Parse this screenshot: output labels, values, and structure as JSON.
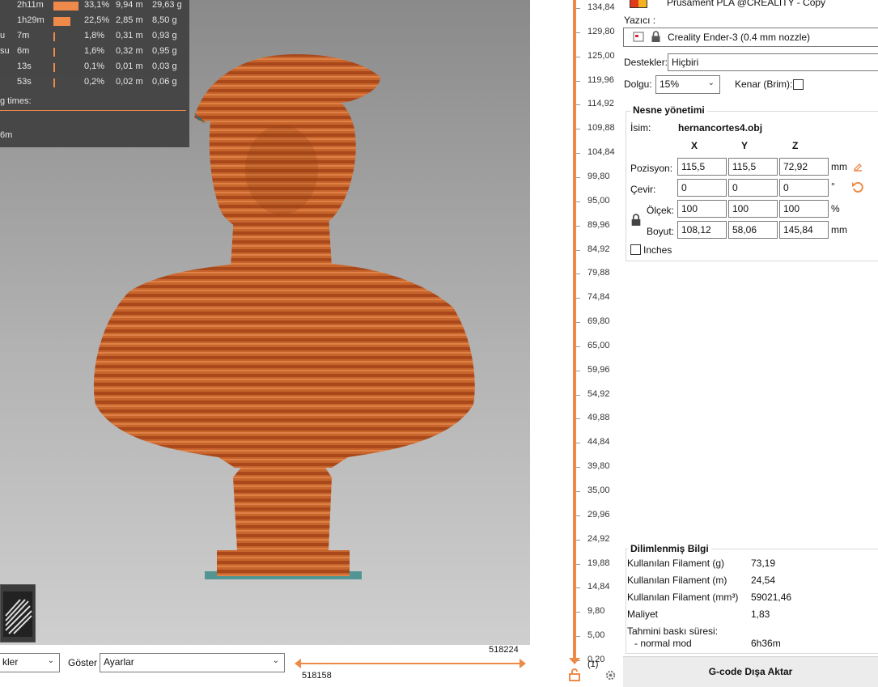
{
  "stats": {
    "rows": [
      {
        "name": "",
        "time": "2h11m",
        "pct": "33,1%",
        "length": "9,94 m",
        "weight": "29,63 g",
        "fraction": 1.0
      },
      {
        "name": "",
        "time": "1h29m",
        "pct": "22,5%",
        "length": "2,85 m",
        "weight": "8,50 g",
        "fraction": 0.68
      },
      {
        "name": "u",
        "time": "7m",
        "pct": "1,8%",
        "length": "0,31 m",
        "weight": "0,93 g",
        "fraction": 0.05
      },
      {
        "name": "su",
        "time": "6m",
        "pct": "1,6%",
        "length": "0,32 m",
        "weight": "0,95 g",
        "fraction": 0.05
      },
      {
        "name": "",
        "time": "13s",
        "pct": "0,1%",
        "length": "0,01 m",
        "weight": "0,03 g",
        "fraction": 0.02
      },
      {
        "name": "",
        "time": "53s",
        "pct": "0,2%",
        "length": "0,02 m",
        "weight": "0,06 g",
        "fraction": 0.02
      }
    ],
    "times_label": "g times:",
    "time_value": "6m"
  },
  "bottom": {
    "view_combo": "kler",
    "show_label": "Göster",
    "show_combo": "Ayarlar",
    "slider_top_value": "518224",
    "slider_bottom_value": "518158"
  },
  "vslider": {
    "labels": [
      "134,84",
      "129,80",
      "125,00",
      "119,96",
      "114,92",
      "109,88",
      "104,84",
      "99,80",
      "95,00",
      "89,96",
      "84,92",
      "79,88",
      "74,84",
      "69,80",
      "65,00",
      "59,96",
      "54,92",
      "49,88",
      "44,84",
      "39,80",
      "35,00",
      "29,96",
      "24,92",
      "19,88",
      "14,84",
      "9,80",
      "5,00",
      "0,20"
    ],
    "bottom_count": "(1)",
    "accent": "#ed8a47"
  },
  "panel": {
    "filament_name": "Prusament PLA @CREALITY - Copy",
    "printer_label": "Yazıcı :",
    "printer_name": "Creality Ender-3 (0.4 mm nozzle)",
    "supports_label": "Destekler:",
    "supports_value": "Hiçbiri",
    "infill_label": "Dolgu:",
    "infill_value": "15%",
    "brim_label": "Kenar (Brim):",
    "object": {
      "title": "Nesne yönetimi",
      "name_label": "İsim:",
      "name_value": "hernancortes4.obj",
      "col_x": "X",
      "col_y": "Y",
      "col_z": "Z",
      "position_label": "Pozisyon:",
      "position": [
        "115,5",
        "115,5",
        "72,92"
      ],
      "position_unit": "mm",
      "rotate_label": "Çevir:",
      "rotate": [
        "0",
        "0",
        "0"
      ],
      "rotate_unit": "°",
      "scale_label": "Ölçek:",
      "scale": [
        "100",
        "100",
        "100"
      ],
      "scale_unit": "%",
      "size_label": "Boyut:",
      "size": [
        "108,12",
        "58,06",
        "145,84"
      ],
      "size_unit": "mm",
      "inches_label": "Inches"
    },
    "sliced": {
      "title": "Dilimlenmiş Bilgi",
      "rows": [
        {
          "label": "Kullanılan Filament (g)",
          "value": "73,19"
        },
        {
          "label": "Kullanılan Filament (m)",
          "value": "24,54"
        },
        {
          "label": "Kullanılan Filament (mm³)",
          "value": "59021,46"
        },
        {
          "label": "Maliyet",
          "value": "1,83"
        }
      ],
      "time_label": "Tahmini baskı süresi:",
      "mode_label": "- normal mod",
      "mode_value": "6h36m"
    },
    "export_button": "G-code Dışa Aktar"
  },
  "colors": {
    "model": "#c5622a",
    "accent": "#ed8a47",
    "stats_bg": "#404040"
  },
  "icons": [
    "printer-icon",
    "lock-icon",
    "edit-icon",
    "undo-icon",
    "layers-icon",
    "settings-icon"
  ]
}
